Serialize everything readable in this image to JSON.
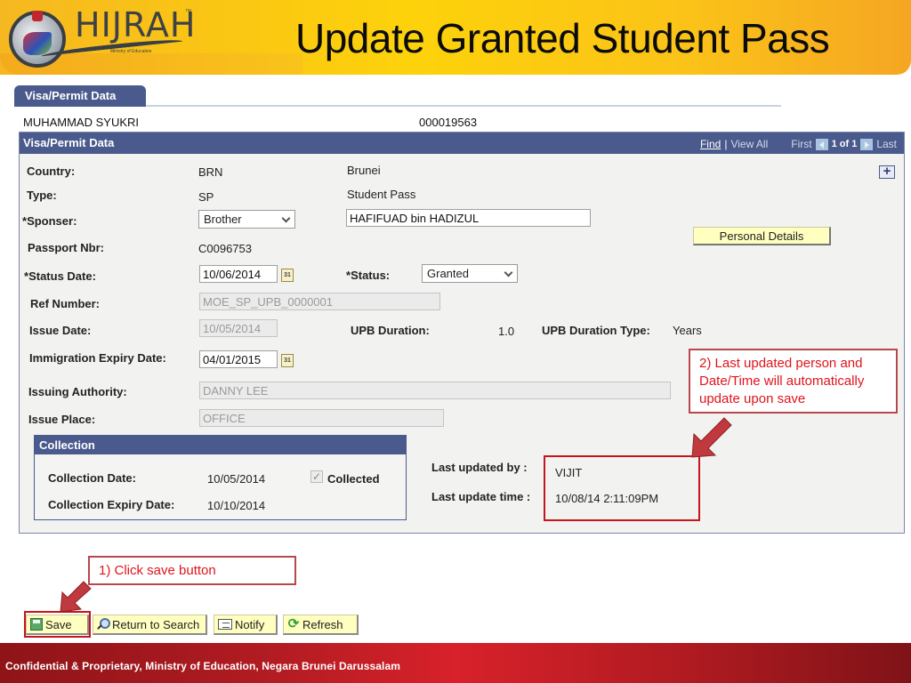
{
  "header": {
    "logo_text": "HIJRAH",
    "logo_tm": "™",
    "logo_subtitle": "Ministry of Education",
    "title": "Update Granted Student Pass"
  },
  "tab": {
    "label": "Visa/Permit Data"
  },
  "student": {
    "name": "MUHAMMAD SYUKRI",
    "id": "000019563"
  },
  "panel": {
    "title": "Visa/Permit Data",
    "nav": {
      "find": "Find",
      "separator": "|",
      "view_all": "View All",
      "first": "First",
      "count": "1 of 1",
      "last": "Last"
    },
    "expand_icon": "+",
    "fields": {
      "country": {
        "label": "Country:",
        "code": "BRN",
        "name": "Brunei"
      },
      "type": {
        "label": "Type:",
        "code": "SP",
        "name": "Student Pass"
      },
      "sponser": {
        "label": "Sponser:",
        "selected": "Brother",
        "name_value": "HAFIFUAD bin HADIZUL"
      },
      "passport": {
        "label": "Passport Nbr:",
        "value": "C0096753"
      },
      "status_date": {
        "label": "Status Date:",
        "value": "10/06/2014"
      },
      "status": {
        "label": "Status:",
        "selected": "Granted"
      },
      "ref_number": {
        "label": "Ref Number:",
        "value": "MOE_SP_UPB_0000001"
      },
      "issue_date": {
        "label": "Issue Date:",
        "value": "10/05/2014"
      },
      "upb_duration": {
        "label": "UPB Duration:",
        "value": "1.0"
      },
      "upb_duration_type": {
        "label": "UPB Duration Type:",
        "value": "Years"
      },
      "immigration_expiry": {
        "label": "Immigration Expiry Date:",
        "value": "04/01/2015"
      },
      "issuing_authority": {
        "label": "Issuing Authority:",
        "value": "DANNY LEE"
      },
      "issue_place": {
        "label": "Issue Place:",
        "value": "OFFICE"
      }
    },
    "calendar_icon_text": "31",
    "personal_details_button": "Personal Details",
    "collection": {
      "title": "Collection",
      "collection_date": {
        "label": "Collection Date:",
        "value": "10/05/2014"
      },
      "collected": {
        "label": "Collected",
        "checked": true
      },
      "collection_expiry": {
        "label": "Collection Expiry Date:",
        "value": "10/10/2014"
      }
    },
    "last_updated_by": {
      "label": "Last updated by :",
      "value": "VIJIT"
    },
    "last_update_time": {
      "label": "Last update time :",
      "value": "10/08/14  2:11:09PM"
    }
  },
  "callouts": {
    "step1": "1) Click save button",
    "step2": "2) Last updated person and Date/Time will automatically update upon save"
  },
  "toolbar": {
    "save": "Save",
    "return_to_search": "Return to Search",
    "notify": "Notify",
    "refresh": "Refresh"
  },
  "footer": {
    "text": "Confidential & Proprietary, Ministry of Education, Negara Brunei Darussalam"
  },
  "colors": {
    "panel_header": "#4a5a8c",
    "callout_red": "#e0141c",
    "button_yellow": "#ffffc0",
    "banner_yellow": "#fdd20a",
    "footer_red": "#d8212a"
  }
}
